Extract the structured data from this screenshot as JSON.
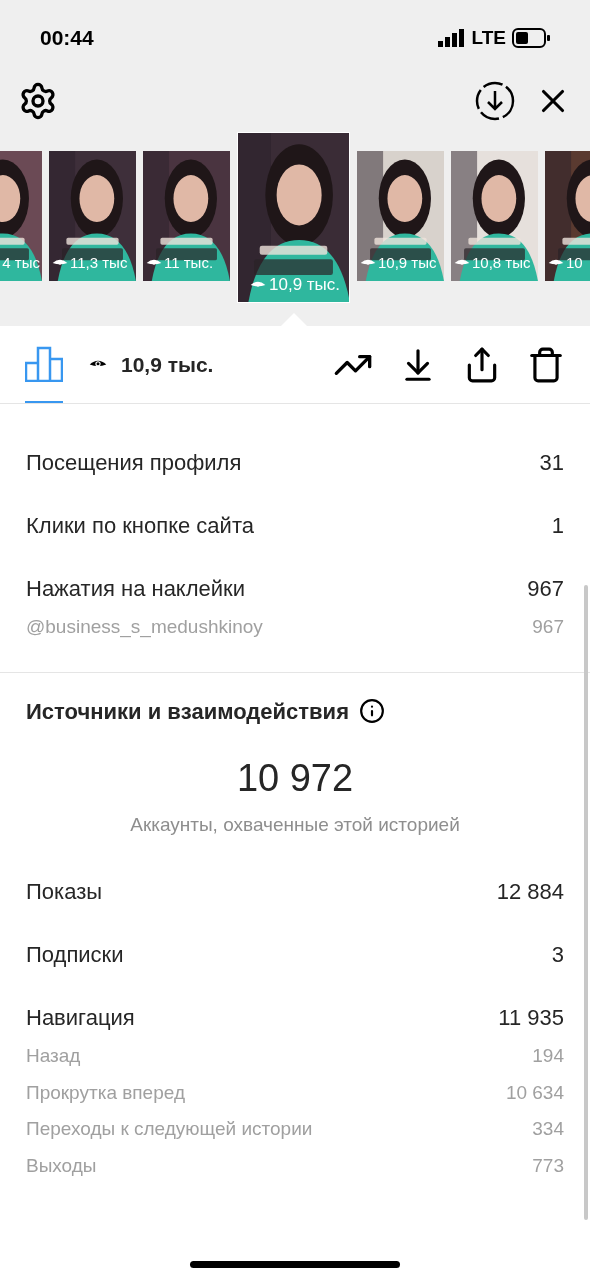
{
  "status_bar": {
    "time": "00:44",
    "network": "LTE"
  },
  "stories": [
    {
      "views": "4 тыс",
      "selected": false
    },
    {
      "views": "11,3 тыс",
      "selected": false
    },
    {
      "views": "11 тыс.",
      "selected": false
    },
    {
      "views": "10,9 тыс.",
      "selected": true
    },
    {
      "views": "10,9 тыс",
      "selected": false
    },
    {
      "views": "10,8 тыс",
      "selected": false
    },
    {
      "views": "10",
      "selected": false
    }
  ],
  "toolbar": {
    "insights_tab": {
      "selected": true
    },
    "views": "10,9 тыс."
  },
  "interactions": [
    {
      "kind": "main",
      "label": "Посещения профиля",
      "value": "31"
    },
    {
      "kind": "main",
      "label": "Клики по кнопке сайта",
      "value": "1"
    },
    {
      "kind": "main",
      "label": "Нажатия на наклейки",
      "value": "967"
    },
    {
      "kind": "sub",
      "label": "@business_s_medushkinoy",
      "value": "967"
    }
  ],
  "discovery": {
    "title": "Источники и взаимодействия",
    "reach": "10 972",
    "reach_caption": "Аккаунты, охваченные этой историей",
    "rows": [
      {
        "kind": "main",
        "label": "Показы",
        "value": "12 884"
      },
      {
        "kind": "main",
        "label": "Подписки",
        "value": "3"
      },
      {
        "kind": "main",
        "label": "Навигация",
        "value": "11 935"
      },
      {
        "kind": "sub",
        "label": "Назад",
        "value": "194"
      },
      {
        "kind": "sub",
        "label": "Прокрутка вперед",
        "value": "10 634"
      },
      {
        "kind": "sub",
        "label": "Переходы к следующей истории",
        "value": "334"
      },
      {
        "kind": "sub",
        "label": "Выходы",
        "value": "773"
      }
    ]
  }
}
